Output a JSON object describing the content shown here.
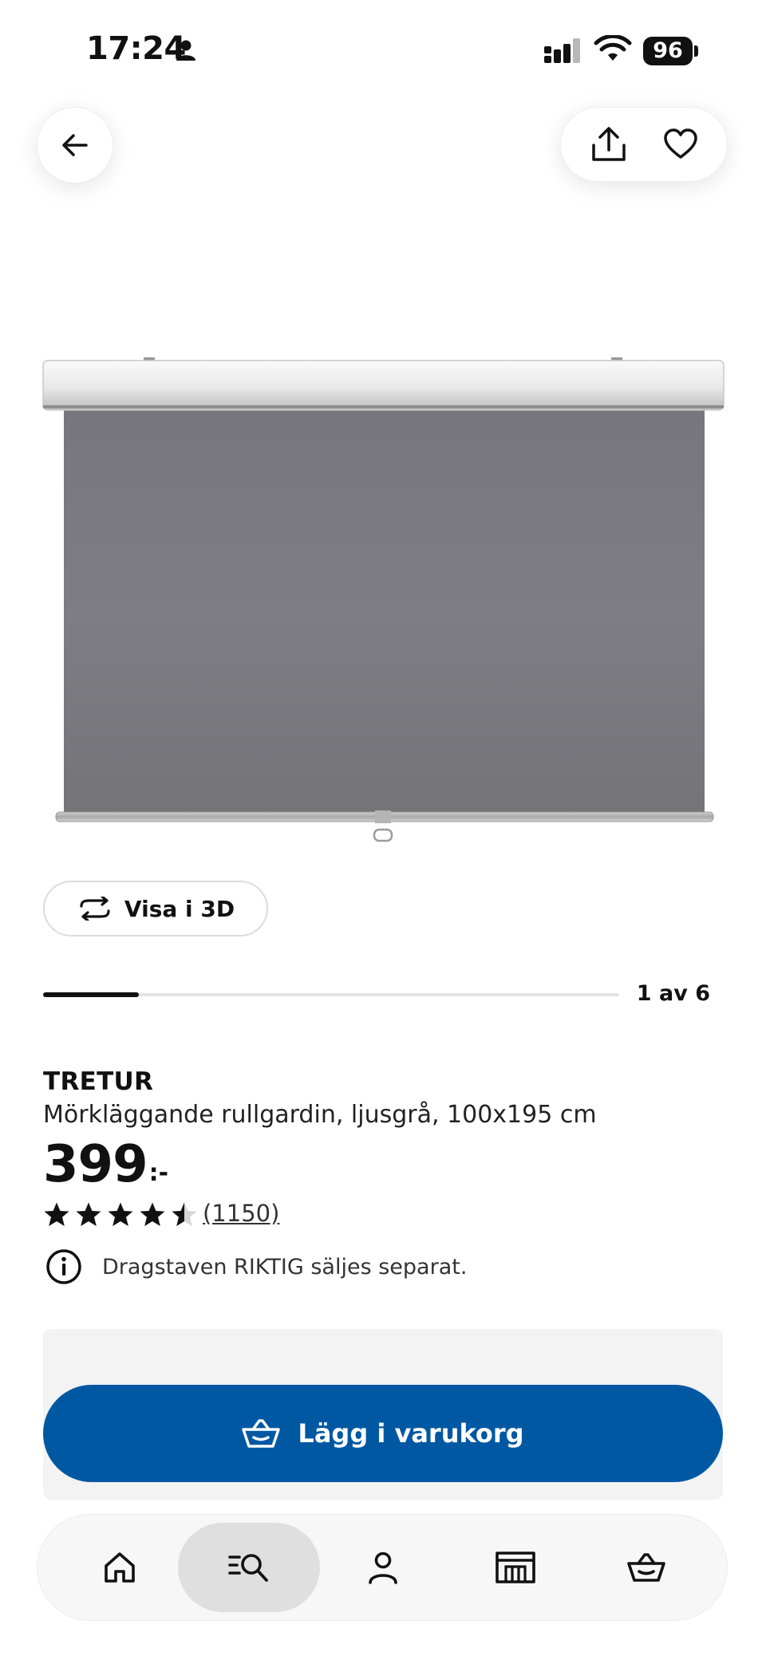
{
  "status_bar": {
    "time": "17:24",
    "battery": "96"
  },
  "header": {
    "back_icon": "arrow-left-icon",
    "share_icon": "share-icon",
    "favorite_icon": "heart-icon"
  },
  "gallery": {
    "view_3d_label": "Visa i 3D",
    "counter": "1 av 6",
    "progress_fraction": 0.1667
  },
  "product": {
    "brand": "TRETUR",
    "description": "Mörkläggande rullgardin, ljusgrå, 100x195 cm",
    "price_integer": "399",
    "price_suffix": ":-",
    "rating": 4.5,
    "rating_max": 5,
    "review_count": "(1150)",
    "info_note": "Dragstaven RIKTIG säljes separat."
  },
  "cart": {
    "button_label": "Lägg i varukorg"
  },
  "bottom_nav": {
    "items": [
      {
        "icon": "home-icon",
        "active": false
      },
      {
        "icon": "search-icon",
        "active": true
      },
      {
        "icon": "user-icon",
        "active": false
      },
      {
        "icon": "store-icon",
        "active": false
      },
      {
        "icon": "basket-icon",
        "active": false
      }
    ]
  },
  "colors": {
    "primary_blue": "#0058a3",
    "text": "#111111",
    "panel_bg": "#f3f3f3"
  }
}
